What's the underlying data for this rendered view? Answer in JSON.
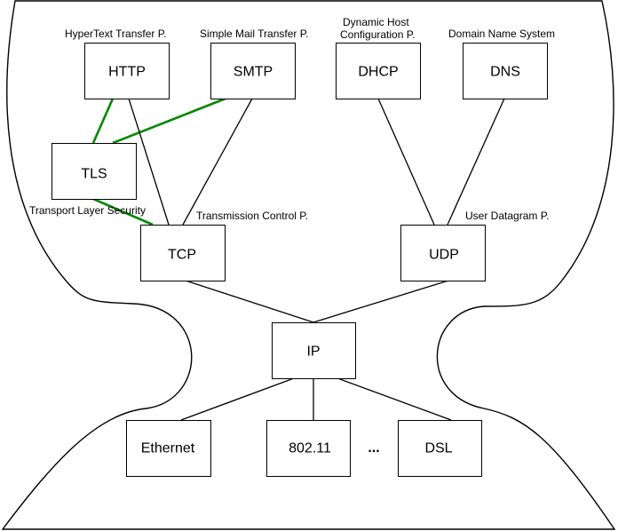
{
  "diagram": {
    "title": "",
    "colors": {
      "edge": "#000000",
      "tls_edge": "#008800",
      "box_fill": "#ffffff"
    },
    "nodes": [
      {
        "id": "http",
        "label": "HTTP",
        "description": "HyperText Transfer P."
      },
      {
        "id": "smtp",
        "label": "SMTP",
        "description": "Simple Mail Transfer P."
      },
      {
        "id": "dhcp",
        "label": "DHCP",
        "description_lines": [
          "Dynamic Host",
          "Configuration P."
        ]
      },
      {
        "id": "dns",
        "label": "DNS",
        "description": "Domain Name System"
      },
      {
        "id": "tls",
        "label": "TLS",
        "description": "Transport Layer Security"
      },
      {
        "id": "tcp",
        "label": "TCP",
        "description": "Transmission Control P."
      },
      {
        "id": "udp",
        "label": "UDP",
        "description": "User Datagram P."
      },
      {
        "id": "ip",
        "label": "IP"
      },
      {
        "id": "ethernet",
        "label": "Ethernet"
      },
      {
        "id": "wifi",
        "label": "802.11"
      },
      {
        "id": "dsl",
        "label": "DSL"
      }
    ],
    "ellipsis": "...",
    "edges": [
      {
        "from": "http",
        "to": "tls",
        "style": "green"
      },
      {
        "from": "smtp",
        "to": "tls",
        "style": "green"
      },
      {
        "from": "tls",
        "to": "tcp",
        "style": "green"
      },
      {
        "from": "http",
        "to": "tcp",
        "style": "black"
      },
      {
        "from": "smtp",
        "to": "tcp",
        "style": "black"
      },
      {
        "from": "dhcp",
        "to": "udp",
        "style": "black"
      },
      {
        "from": "dns",
        "to": "udp",
        "style": "black"
      },
      {
        "from": "tcp",
        "to": "ip",
        "style": "black"
      },
      {
        "from": "udp",
        "to": "ip",
        "style": "black"
      },
      {
        "from": "ip",
        "to": "ethernet",
        "style": "black"
      },
      {
        "from": "ip",
        "to": "wifi",
        "style": "black"
      },
      {
        "from": "ip",
        "to": "dsl",
        "style": "black"
      }
    ]
  }
}
